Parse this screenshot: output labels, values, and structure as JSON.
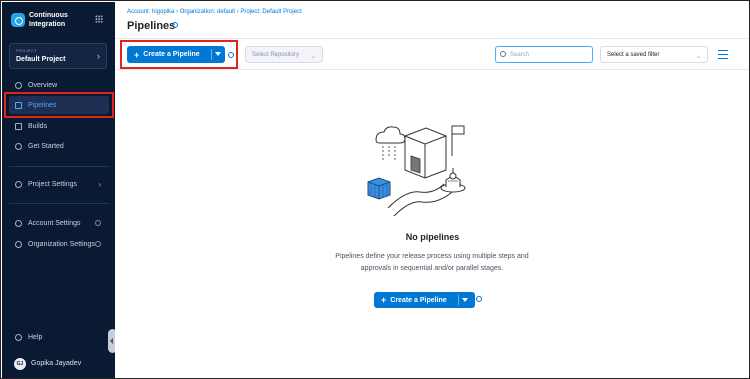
{
  "app": {
    "name": "Continuous Integration"
  },
  "project": {
    "caption": "PROJECT",
    "name": "Default Project"
  },
  "sidebar": {
    "items": [
      {
        "label": "Overview",
        "icon": "overview-icon"
      },
      {
        "label": "Pipelines",
        "icon": "pipelines-icon",
        "active": true
      },
      {
        "label": "Builds",
        "icon": "builds-icon"
      },
      {
        "label": "Get Started",
        "icon": "get-started-icon"
      }
    ],
    "project_settings": "Project Settings",
    "account_settings": "Account Settings",
    "organization_settings": "Organization Settings",
    "help": "Help",
    "user_initials": "GJ",
    "user_name": "Gopika Jayadev"
  },
  "breadcrumb": {
    "text": "Account: higopika  ›  Organization: default  ›  Project: Default Project"
  },
  "page": {
    "title": "Pipelines"
  },
  "toolbar": {
    "create_label": "Create a Pipeline",
    "repo_placeholder": "Select Repository",
    "search_placeholder": "Search",
    "filter_placeholder": "Select a saved filter"
  },
  "empty_state": {
    "title": "No pipelines",
    "description": "Pipelines define your release process using multiple steps and approvals in sequential and/or parallel stages.",
    "create_label": "Create a Pipeline"
  },
  "colors": {
    "accent": "#0278d5",
    "sidebar_bg": "#0b1a33",
    "highlight": "#e2231a"
  }
}
